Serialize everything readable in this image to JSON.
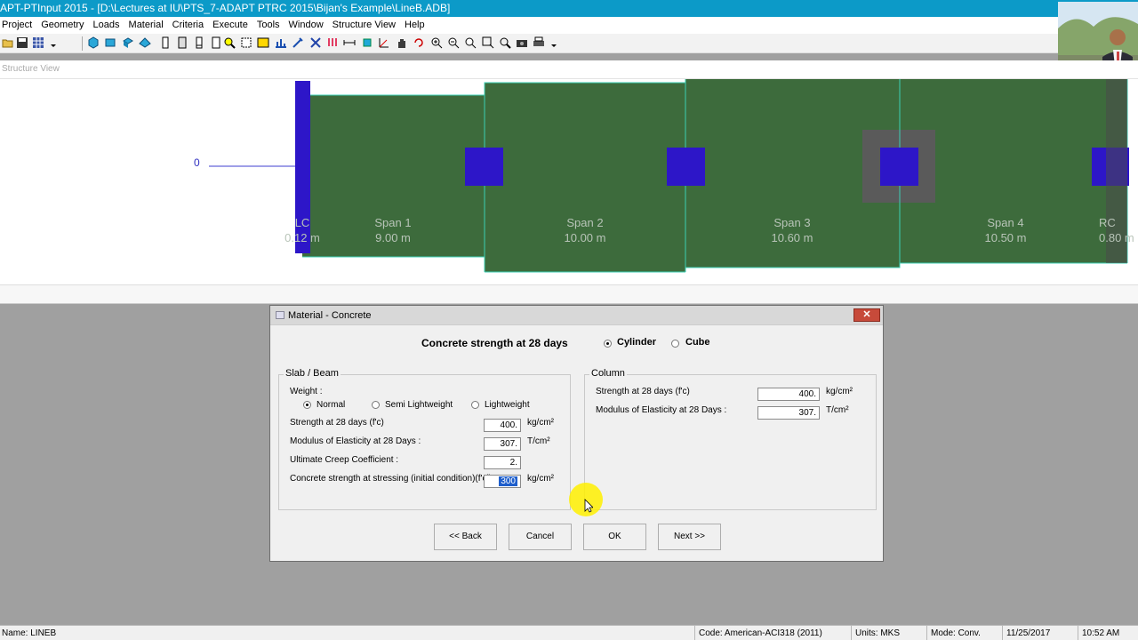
{
  "window": {
    "title": "APT-PTInput 2015 - [D:\\Lectures at IU\\PTS_7-ADAPT PTRC 2015\\Bijan's Example\\LineB.ADB]"
  },
  "menu": [
    "Project",
    "Geometry",
    "Loads",
    "Material",
    "Criteria",
    "Execute",
    "Tools",
    "Window",
    "Structure View",
    "Help"
  ],
  "structure_view": {
    "title": "Structure View",
    "axis_zero": "0",
    "left_cantilever": {
      "name": "LC",
      "length": "0.12 m"
    },
    "right_cantilever": {
      "name": "RC",
      "length": "0.80 m"
    },
    "spans": [
      {
        "name": "Span 1",
        "length": "9.00 m"
      },
      {
        "name": "Span 2",
        "length": "10.00 m"
      },
      {
        "name": "Span 3",
        "length": "10.60 m"
      },
      {
        "name": "Span 4",
        "length": "10.50 m"
      }
    ],
    "colors": {
      "slab": "#3d6b3c",
      "column": "#2d16c8",
      "drop": "#5a5a5a",
      "outline": "#3ccfb4"
    }
  },
  "dialog": {
    "title": "Material - Concrete",
    "close": "✕",
    "heading": "Concrete strength at 28 days",
    "cylinder": "Cylinder",
    "cube": "Cube",
    "slab": {
      "title": "Slab / Beam",
      "weight_label": "Weight :",
      "normal": "Normal",
      "semi": "Semi Lightweight",
      "light": "Lightweight",
      "strength_label": "Strength at 28 days (f'c)",
      "strength_value": "400.",
      "strength_unit": "kg/cm²",
      "modulus_label": "Modulus of Elasticity at 28 Days :",
      "modulus_value": "307.",
      "modulus_unit": "T/cm²",
      "creep_label": "Ultimate Creep Coefficient :",
      "creep_value": "2.",
      "stressing_label": "Concrete strength at stressing (initial condition)(f'ci) :",
      "stressing_value": "300",
      "stressing_unit": "kg/cm²"
    },
    "column": {
      "title": "Column",
      "strength_label": "Strength at 28 days (f'c)",
      "strength_value": "400.",
      "strength_unit": "kg/cm²",
      "modulus_label": "Modulus of Elasticity at 28 Days :",
      "modulus_value": "307.",
      "modulus_unit": "T/cm²"
    },
    "buttons": {
      "back": "<< Back",
      "cancel": "Cancel",
      "ok": "OK",
      "next": "Next >>"
    }
  },
  "status": {
    "name": "Name: LINEB",
    "code": "Code: American-ACI318 (2011)",
    "units": "Units: MKS",
    "mode": "Mode: Conv.",
    "date": "11/25/2017",
    "time": "10:52 AM"
  }
}
